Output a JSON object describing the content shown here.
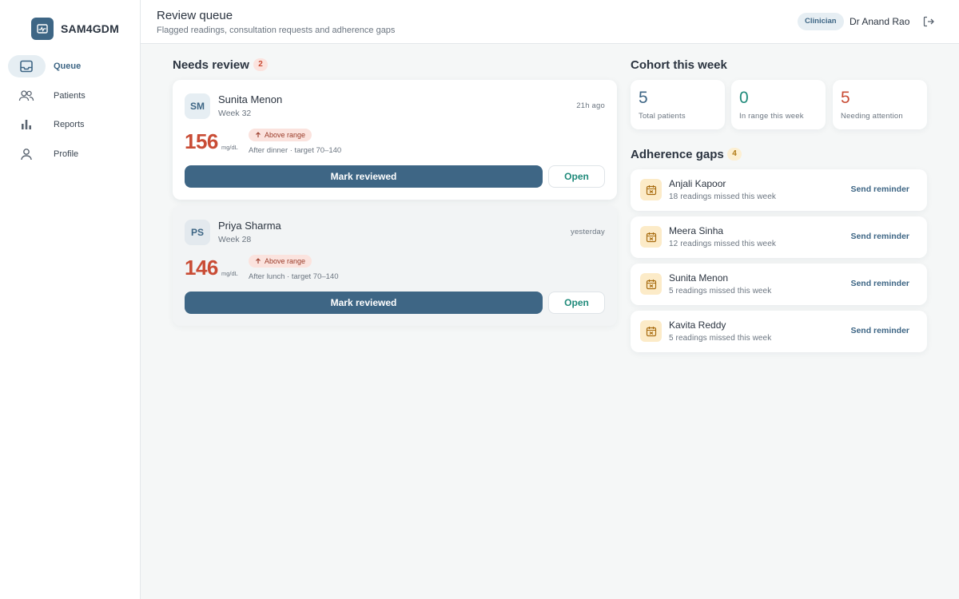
{
  "app": {
    "name": "SAM4GDM"
  },
  "sidebar": {
    "items": [
      {
        "label": "Queue",
        "icon": "inbox-icon",
        "active": true
      },
      {
        "label": "Patients",
        "icon": "users-icon",
        "active": false
      },
      {
        "label": "Reports",
        "icon": "bar-chart-icon",
        "active": false
      },
      {
        "label": "Profile",
        "icon": "user-icon",
        "active": false
      }
    ]
  },
  "header": {
    "title": "Review queue",
    "subtitle": "Flagged readings, consultation requests and adherence gaps",
    "role": "Clinician",
    "user": "Dr Anand Rao"
  },
  "needs_review": {
    "title": "Needs review",
    "count": "2",
    "items": [
      {
        "initials": "SM",
        "name": "Sunita Menon",
        "week": "Week 32",
        "time": "21h ago",
        "value": "156",
        "unit": "mg/dL",
        "flag": "Above range",
        "context": "After dinner · target 70–140",
        "action": "Mark reviewed",
        "open": "Open"
      },
      {
        "initials": "PS",
        "name": "Priya Sharma",
        "week": "Week 28",
        "time": "yesterday",
        "value": "146",
        "unit": "mg/dL",
        "flag": "Above range",
        "context": "After lunch · target 70–140",
        "action": "Mark reviewed",
        "open": "Open"
      }
    ]
  },
  "cohort": {
    "title": "Cohort this week",
    "stats": [
      {
        "value": "5",
        "label": "Total patients",
        "color": "#3e6685"
      },
      {
        "value": "0",
        "label": "In range this week",
        "color": "#1f8a7a"
      },
      {
        "value": "5",
        "label": "Needing attention",
        "color": "#c94c35"
      }
    ]
  },
  "adherence": {
    "title": "Adherence gaps",
    "count": "4",
    "items": [
      {
        "name": "Anjali Kapoor",
        "detail": "18 readings missed this week",
        "action": "Send reminder"
      },
      {
        "name": "Meera Sinha",
        "detail": "12 readings missed this week",
        "action": "Send reminder"
      },
      {
        "name": "Sunita Menon",
        "detail": "5 readings missed this week",
        "action": "Send reminder"
      },
      {
        "name": "Kavita Reddy",
        "detail": "5 readings missed this week",
        "action": "Send reminder"
      }
    ]
  },
  "colors": {
    "primary": "#3e6685",
    "accent": "#1f8a7a",
    "alert": "#c94c35",
    "warning_bg": "#fcebc8"
  }
}
